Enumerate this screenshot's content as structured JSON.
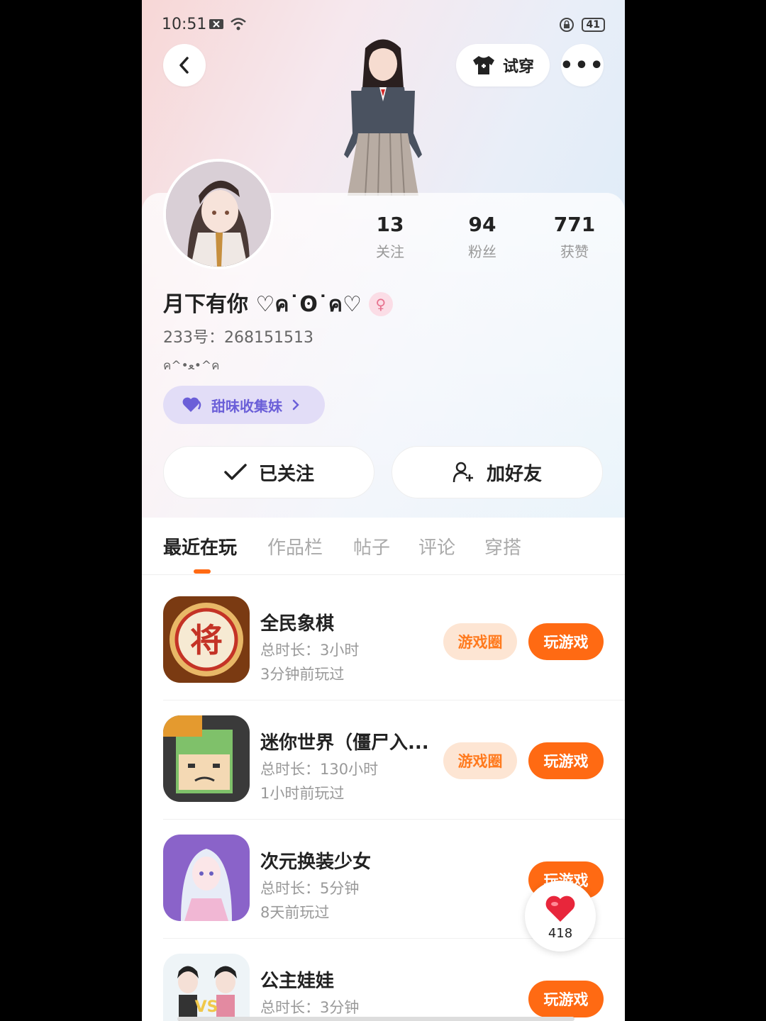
{
  "status_bar": {
    "time": "10:51",
    "battery": "41"
  },
  "header": {
    "try_on_label": "试穿",
    "more_label": "•••"
  },
  "profile": {
    "stats": [
      {
        "num": "13",
        "label": "关注"
      },
      {
        "num": "94",
        "label": "粉丝"
      },
      {
        "num": "771",
        "label": "获赞"
      }
    ],
    "name": "月下有你 ♡ค˙ʘ˙ค♡",
    "uid": "233号：268151513",
    "bio": "ค^•ﻌ•^ค",
    "tag": "甜味收集妹",
    "follow_label": "已关注",
    "add_friend_label": "加好友"
  },
  "tabs": [
    "最近在玩",
    "作品栏",
    "帖子",
    "评论",
    "穿搭"
  ],
  "games": [
    {
      "title": "全民象棋",
      "duration": "总时长：3小时",
      "ago": "3分钟前玩过",
      "circle": "游戏圈",
      "play": "玩游戏"
    },
    {
      "title": "迷你世界（僵尸入...",
      "duration": "总时长：130小时",
      "ago": "1小时前玩过",
      "circle": "游戏圈",
      "play": "玩游戏"
    },
    {
      "title": "次元换装少女",
      "duration": "总时长：5分钟",
      "ago": "8天前玩过",
      "circle": "",
      "play": "玩游戏"
    },
    {
      "title": "公主娃娃",
      "duration": "总时长：3分钟",
      "ago": "",
      "circle": "",
      "play": "玩游戏"
    }
  ],
  "like_bubble": {
    "count": "418"
  },
  "colors": {
    "accent": "#ff6a13",
    "tag_text": "#6b5fd8"
  }
}
